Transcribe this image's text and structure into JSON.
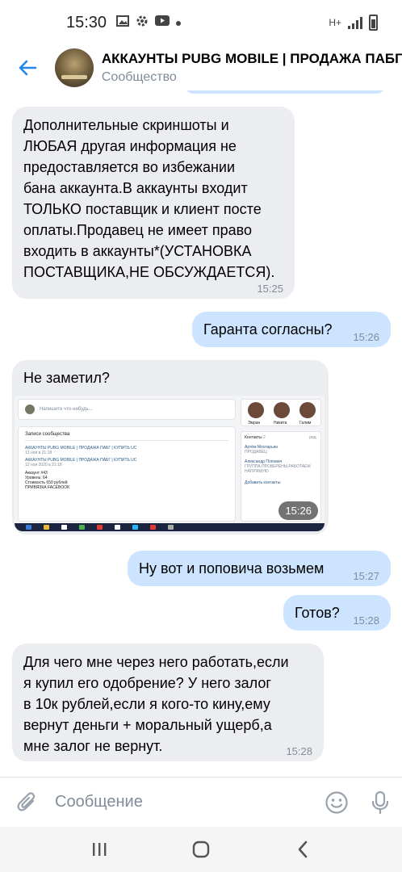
{
  "status_bar": {
    "time": "15:30",
    "network": "H+",
    "icons": [
      "image-icon",
      "gear-icon",
      "youtube-icon",
      "dot-icon"
    ]
  },
  "header": {
    "title": "АККАУНТЫ PUBG MOBILE | ПРОДАЖА ПАБГ",
    "subtitle": "Сообщество"
  },
  "messages": [
    {
      "direction": "in",
      "text": "Дополнительные скриншоты и\nЛЮБАЯ другая информация не\nпредоставляется во избежании\nбана аккаунта.В аккаунты входит\nТОЛЬКО поставщик и клиент посте\nоплаты.Продавец не имеет право\nвходить в аккаунты*(УСТАНОВКА\nПОСТАВЩИКА,НЕ ОБСУЖДАЕТСЯ).",
      "time": "15:25"
    },
    {
      "direction": "out",
      "text": "Гаранта согласны?",
      "time": "15:26"
    },
    {
      "direction": "in",
      "text": "Не заметил?",
      "time": "15:26"
    },
    {
      "direction": "out",
      "text": "Ну вот и поповича возьмем",
      "time": "15:27"
    },
    {
      "direction": "out",
      "text": "Готов?",
      "time": "15:28"
    },
    {
      "direction": "in",
      "text": "Для чего мне через него работать,если\nя купил его одобрение? У него залог\nв 10к рублей,если я кого-то кину,ему\nвернут деньги + моральный ущерб,а\nмне залог не вернут.",
      "time": "15:28"
    }
  ],
  "screenshot": {
    "post_placeholder": "Напишите что-нибудь...",
    "wall_title": "Записи сообщества",
    "post_author": "АККАУНТЫ PUBG MOBILE | ПРОДАЖА ПАБГ | КУПИТЬ UC",
    "post_date_1": "13 ноя в 21:18",
    "post_date_2": "12 ноя 2020 в 21:18",
    "lines": [
      "Аккаунт #43",
      "Уровень: 64",
      "Стоимость 650 рублей",
      "ПРИВЯЗКА FACEBOOK"
    ],
    "friends": [
      "Эмран",
      "Никита",
      "Галим"
    ],
    "contacts_label": "Контакты",
    "contacts_count": "2",
    "contacts_edit": "ред.",
    "contact_1_name": "Артём Мохтарьян",
    "contact_1_role": "ПРОДАВЕЦ",
    "contact_2_name": "Александр Попович",
    "contact_2_role": "ГРУППА ПРОВЕРЕНЫ,РАБОТАЕМ НАПРЯМУЮ",
    "add_contacts": "Добавить контакты"
  },
  "composer": {
    "placeholder": "Сообщение"
  },
  "colors": {
    "incoming_bubble": "#ebedf0",
    "outgoing_bubble": "#cce4ff",
    "accent": "#2688eb",
    "secondary_text": "#818c99"
  }
}
